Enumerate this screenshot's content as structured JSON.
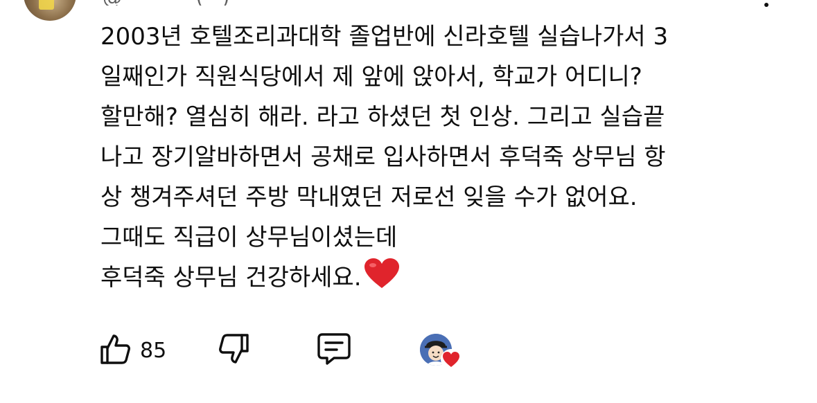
{
  "comment": {
    "header_fragment": "@··········· (···)",
    "lines": [
      "2003년 호텔조리과대학 졸업반에 신라호텔 실습나가서 3",
      "일째인가 직원식당에서 제 앞에 앉아서,  학교가 어디니?",
      "할만해? 열심히 해라. 라고 하셨던 첫 인상. 그리고 실습끝",
      "나고 장기알바하면서 공채로 입사하면서 후덕죽 상무님 항",
      "상 챙겨주셔던 주방 막내였던 저로선 잊을 수가 없어요.",
      "그때도 직급이 상무님이셨는데",
      "후덕죽 상무님 건강하세요."
    ],
    "trailing_emoji": "heart-emoji"
  },
  "actions": {
    "like_icon": "thumbs-up-icon",
    "like_count": "85",
    "dislike_icon": "thumbs-down-icon",
    "reply_icon": "reply-comment-icon",
    "creator_heart_icon": "creator-heart-icon"
  },
  "colors": {
    "text": "#0f0f0f",
    "heart": "#e0242c",
    "creator_avatar_bg": "#4a6fb5"
  }
}
